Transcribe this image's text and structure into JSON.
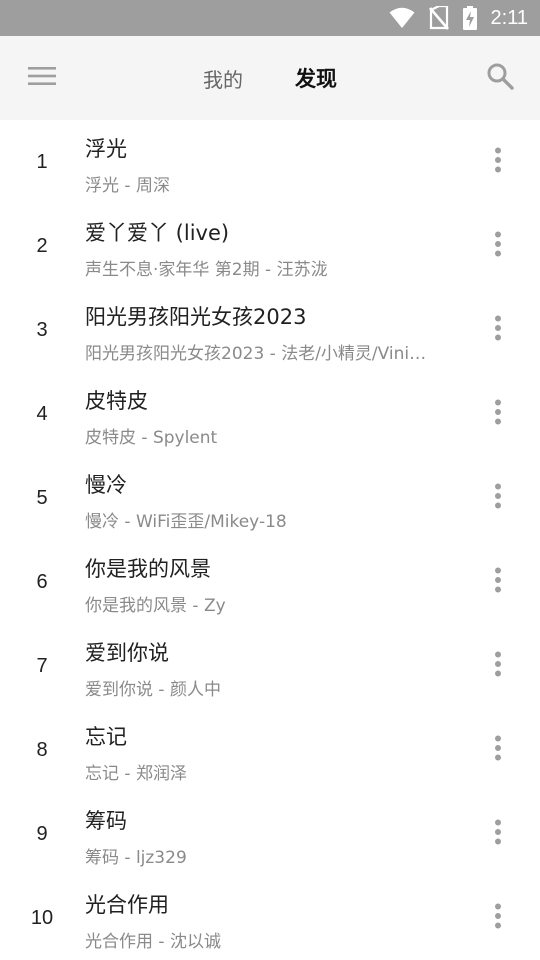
{
  "status_bar": {
    "time": "2:11",
    "icons": [
      "wifi-icon",
      "no-sim-icon",
      "battery-charging-icon"
    ]
  },
  "header": {
    "menu_icon": "menu-icon",
    "tabs": [
      {
        "label": "我的",
        "active": false
      },
      {
        "label": "发现",
        "active": true
      }
    ],
    "search_icon": "search-icon"
  },
  "songs": [
    {
      "rank": "1",
      "title": "浮光",
      "subtitle": "浮光 - 周深"
    },
    {
      "rank": "2",
      "title": "爱丫爱丫 (live)",
      "subtitle": "声生不息·家年华 第2期 - 汪苏泷"
    },
    {
      "rank": "3",
      "title": "阳光男孩阳光女孩2023",
      "subtitle": "阳光男孩阳光女孩2023 - 法老/小精灵/Vini…"
    },
    {
      "rank": "4",
      "title": "皮特皮",
      "subtitle": "皮特皮 - Spylent"
    },
    {
      "rank": "5",
      "title": "慢冷",
      "subtitle": "慢冷 - WiFi歪歪/Mikey-18"
    },
    {
      "rank": "6",
      "title": "你是我的风景",
      "subtitle": "你是我的风景 - Zy"
    },
    {
      "rank": "7",
      "title": "爱到你说",
      "subtitle": "爱到你说 - 颜人中"
    },
    {
      "rank": "8",
      "title": "忘记",
      "subtitle": "忘记 - 郑润泽"
    },
    {
      "rank": "9",
      "title": "筹码",
      "subtitle": "筹码 - ljz329"
    },
    {
      "rank": "10",
      "title": "光合作用",
      "subtitle": "光合作用 - 沈以诚"
    }
  ],
  "colors": {
    "status_bar": "#9e9e9e",
    "app_bar": "#f5f5f5",
    "title_text": "#212121",
    "subtitle_text": "#8a8a8a",
    "icon": "#9e9e9e"
  }
}
